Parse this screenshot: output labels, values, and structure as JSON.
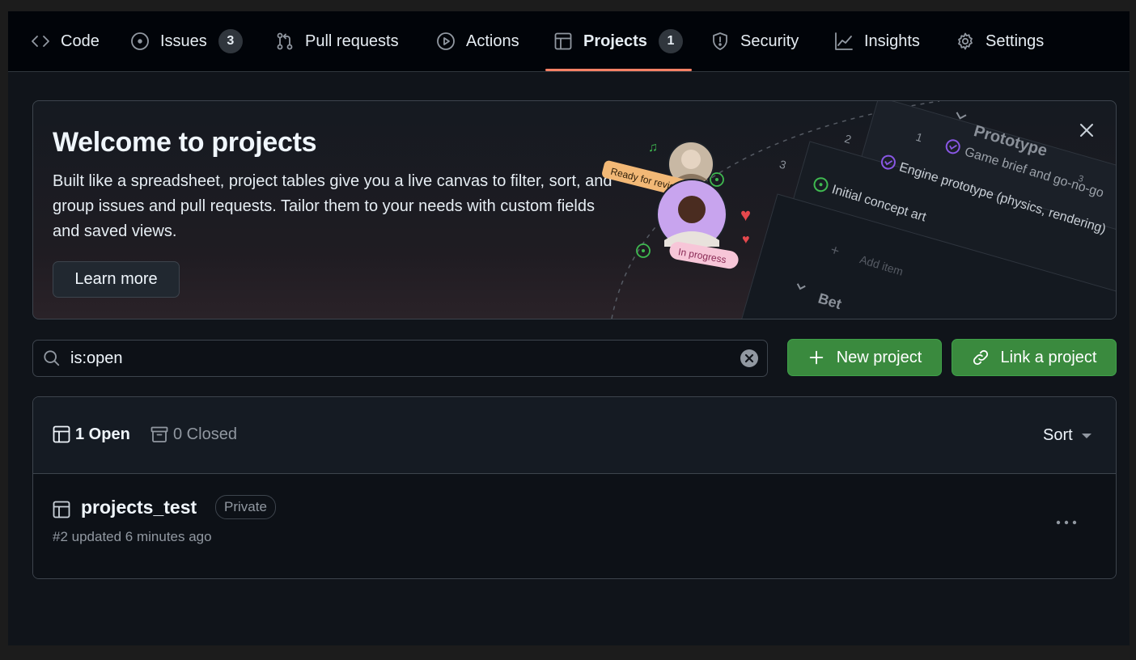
{
  "nav": {
    "tabs": [
      {
        "label": "Code",
        "icon": "code-icon"
      },
      {
        "label": "Issues",
        "icon": "issue-opened-icon",
        "count": "3"
      },
      {
        "label": "Pull requests",
        "icon": "git-pull-request-icon"
      },
      {
        "label": "Actions",
        "icon": "play-icon"
      },
      {
        "label": "Projects",
        "icon": "table-icon",
        "count": "1",
        "active": true
      },
      {
        "label": "Security",
        "icon": "shield-icon"
      },
      {
        "label": "Insights",
        "icon": "graph-icon"
      },
      {
        "label": "Settings",
        "icon": "gear-icon"
      }
    ],
    "active_underline_color": "#f78166"
  },
  "banner": {
    "title": "Welcome to projects",
    "description": "Built like a spreadsheet, project tables give you a live canvas to filter, sort, and group issues and pull requests. Tailor them to your needs with custom fields and saved views.",
    "learn_more_label": "Learn more",
    "illustration": {
      "ready_label": "Ready for review",
      "progress_label": "In progress",
      "group_label": "Prototype",
      "group_count": "3",
      "rows": [
        {
          "num": "1",
          "text": "Game brief and go-no-go"
        },
        {
          "num": "2",
          "text": "Engine prototype (physics, rendering)"
        },
        {
          "num": "3",
          "text": "Initial concept art"
        }
      ],
      "add_item": "Add item",
      "next_group": "Bet"
    }
  },
  "search": {
    "value": "is:open"
  },
  "actions": {
    "new_project_label": "New project",
    "link_project_label": "Link a project",
    "button_color": "#3a8a3e"
  },
  "list": {
    "open_label": "1 Open",
    "closed_label": "0 Closed",
    "sort_label": "Sort",
    "projects": [
      {
        "name": "projects_test",
        "visibility": "Private",
        "meta": "#2 updated 6 minutes ago"
      }
    ]
  }
}
